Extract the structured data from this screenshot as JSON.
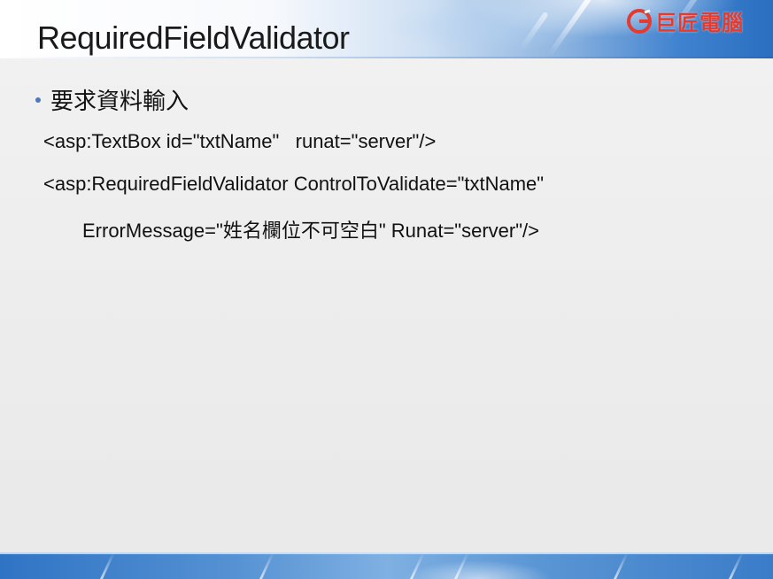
{
  "slide": {
    "title": "RequiredFieldValidator",
    "logo_text": "巨匠電腦",
    "bullet": "要求資料輸入",
    "code_lines": [
      "<asp:TextBox id=\"txtName\"   runat=\"server\"/>",
      "<asp:RequiredFieldValidator ControlToValidate=\"txtName\"",
      "ErrorMessage=\"姓名欄位不可空白\" Runat=\"server\"/>"
    ]
  },
  "theme": {
    "title_color": "#1a1a1a",
    "logo_color": "#e33b2f",
    "bullet_color": "#4a78b8",
    "band_blue": "#2a6fc0"
  },
  "icons": {
    "logo": "brand-logo-icon",
    "bullet": "bullet-dot-icon"
  }
}
